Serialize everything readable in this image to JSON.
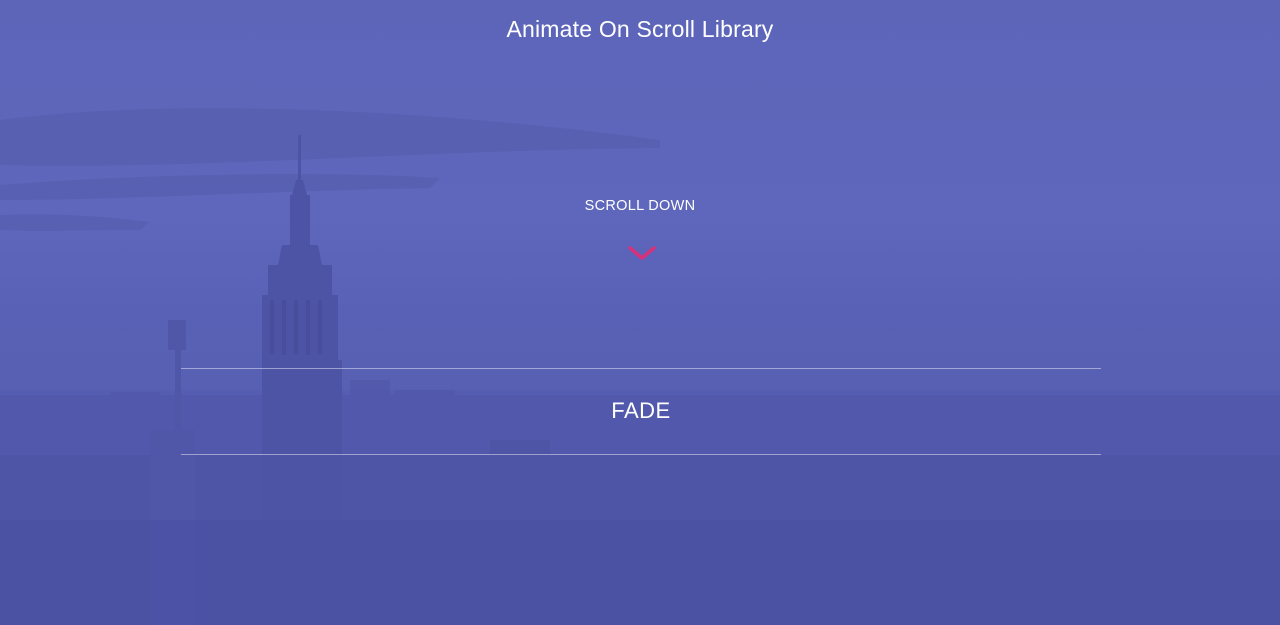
{
  "header": {
    "title": "Animate On Scroll Library"
  },
  "hero": {
    "scroll_hint": "SCROLL DOWN",
    "scroll_icon": "chevron-down-icon",
    "accent_color": "#d9307a",
    "overlay_color": "#5a62b8"
  },
  "sections": [
    {
      "label": "FADE"
    }
  ]
}
